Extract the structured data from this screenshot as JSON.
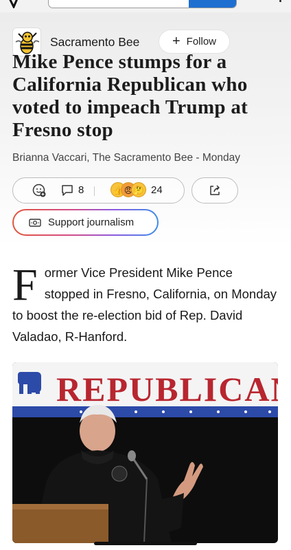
{
  "publisher": {
    "name": "Sacramento Bee",
    "logo_icon": "hornet-mascot-icon",
    "follow_label": "Follow",
    "follow_icon": "plus-icon"
  },
  "article": {
    "headline": "Mike Pence stumps for a California Republican who voted to impeach Trump at Fresno stop",
    "byline": "Brianna Vaccari, The Sacramento Bee - Monday",
    "dropcap": "F",
    "lead": "ormer Vice President Mike Pence stopped in Fresno, California, on Monday to boost the re-election bid of Rep. David Valadao, R-Hanford."
  },
  "engagement": {
    "react_icon": "add-reaction-icon",
    "comment_icon": "comment-icon",
    "comment_count": "8",
    "reaction_emojis": [
      "thumbs-up",
      "angry",
      "thinking"
    ],
    "reaction_count": "24",
    "share_icon": "share-icon"
  },
  "support": {
    "label": "Support journalism",
    "icon": "money-icon"
  },
  "photo": {
    "banner_text": "REPUBLICANS",
    "colors": {
      "banner_red": "#b8262f",
      "banner_blue": "#2c4aa8",
      "background": "#0d0d0d"
    }
  },
  "colors": {
    "accent_blue": "#1f6fd1",
    "support_gradient": [
      "#e2553b",
      "#d44b86",
      "#8a5ae0",
      "#3b8de8"
    ]
  }
}
